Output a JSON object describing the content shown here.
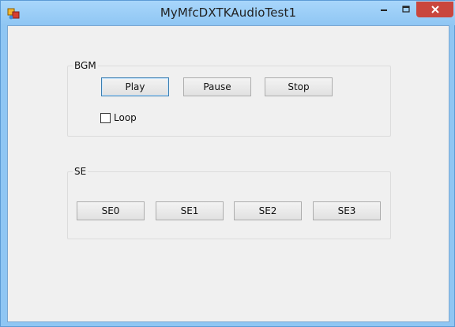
{
  "window": {
    "title": "MyMfcDXTKAudioTest1"
  },
  "bgm": {
    "label": "BGM",
    "buttons": {
      "play": "Play",
      "pause": "Pause",
      "stop": "Stop"
    },
    "loop_label": "Loop",
    "loop_checked": false
  },
  "se": {
    "label": "SE",
    "buttons": [
      "SE0",
      "SE1",
      "SE2",
      "SE3"
    ]
  },
  "icons": {
    "app": "app-icon",
    "minimize": "minimize-icon",
    "maximize": "maximize-icon",
    "close": "close-icon"
  },
  "colors": {
    "titlebar": "#8fc6f3",
    "close": "#c9463d",
    "client": "#f0f0f0"
  }
}
